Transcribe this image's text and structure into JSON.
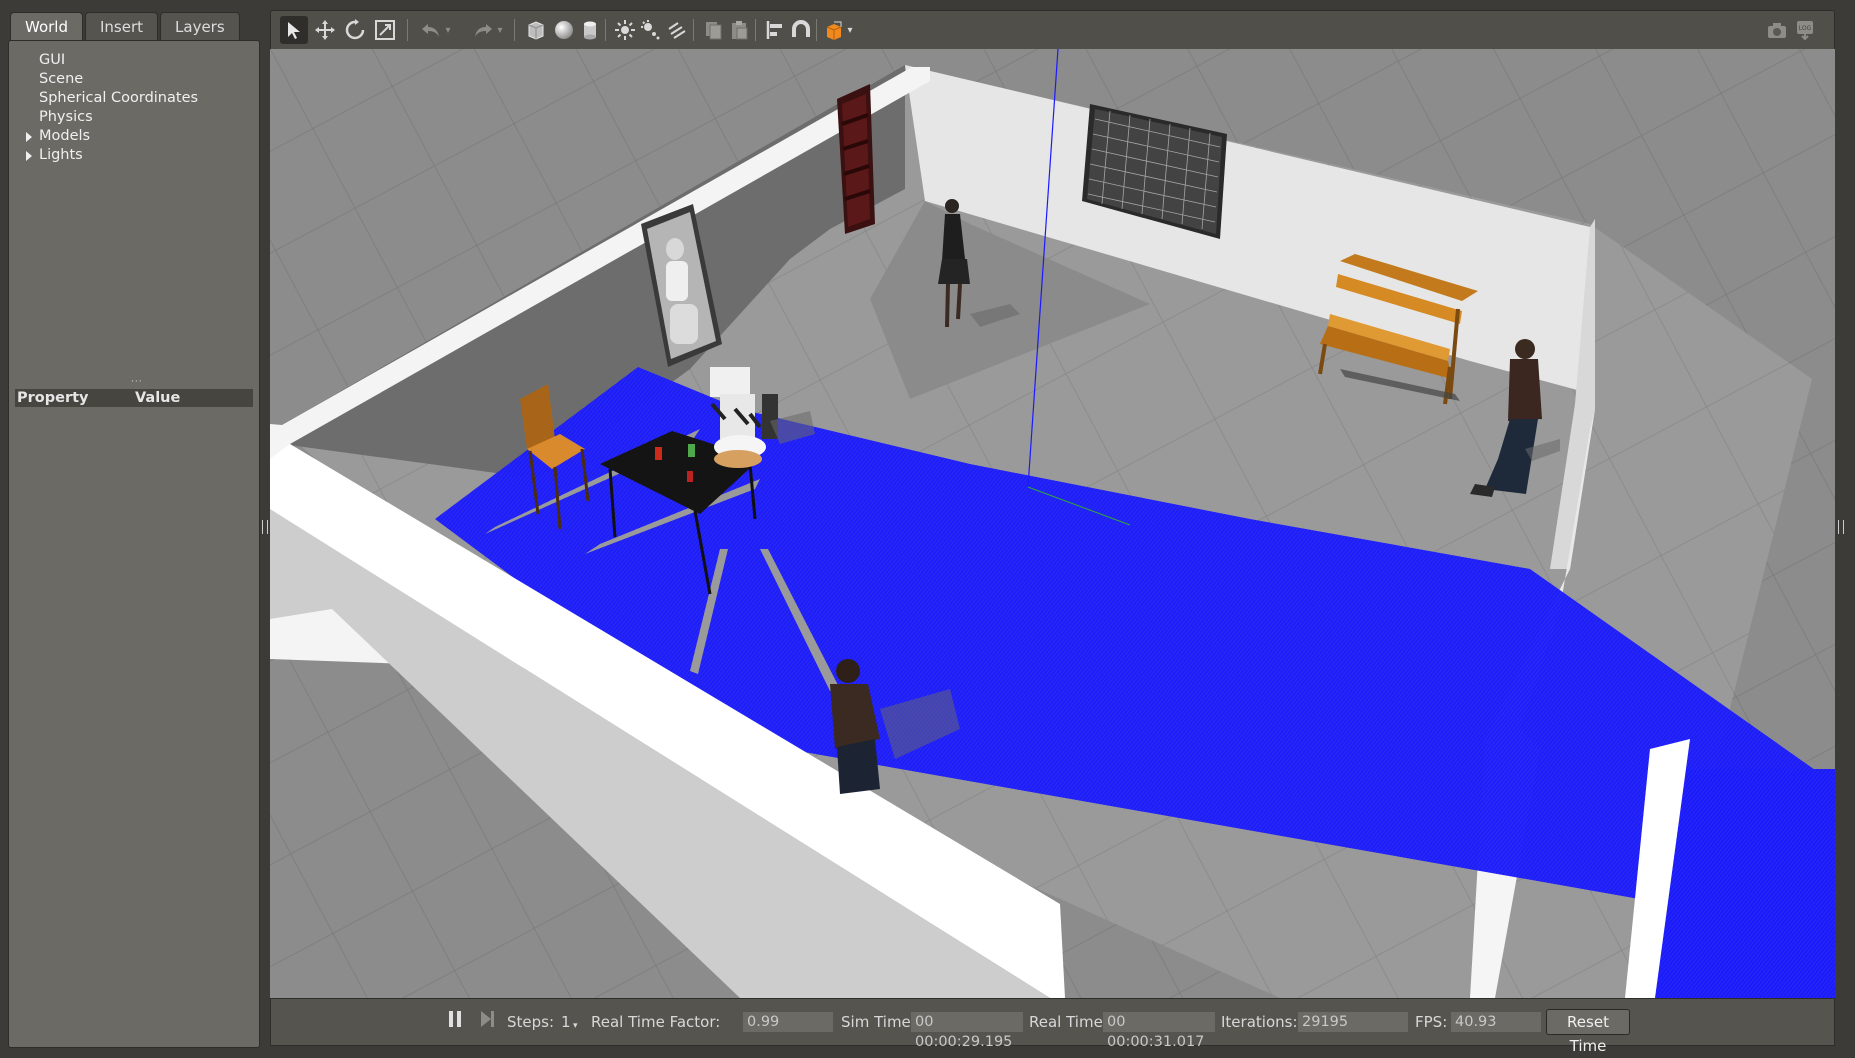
{
  "left_panel": {
    "tabs": [
      "World",
      "Insert",
      "Layers"
    ],
    "tree": [
      {
        "label": "GUI",
        "expandable": false
      },
      {
        "label": "Scene",
        "expandable": false
      },
      {
        "label": "Spherical Coordinates",
        "expandable": false
      },
      {
        "label": "Physics",
        "expandable": false
      },
      {
        "label": "Models",
        "expandable": true
      },
      {
        "label": "Lights",
        "expandable": true
      }
    ],
    "property_header": {
      "property": "Property",
      "value": "Value"
    }
  },
  "toolbar": {
    "tools": [
      "select-arrow-icon",
      "translate-icon",
      "rotate-icon",
      "scale-icon",
      "undo-icon",
      "redo-icon",
      "box-icon",
      "sphere-icon",
      "cylinder-icon",
      "point-light-icon",
      "spot-light-icon",
      "directional-light-icon",
      "copy-icon",
      "paste-icon",
      "align-icon",
      "snap-icon",
      "view-angle-icon",
      "screenshot-icon",
      "log-icon"
    ],
    "active_tool": "select-arrow-icon"
  },
  "statusbar": {
    "steps_label": "Steps:",
    "steps_value": "1",
    "rtf_label": "Real Time Factor:",
    "rtf_value": "0.99",
    "sim_time_label": "Sim Time:",
    "sim_time_value": "00 00:00:29.195",
    "real_time_label": "Real Time:",
    "real_time_value": "00 00:00:31.017",
    "iterations_label": "Iterations:",
    "iterations_value": "29195",
    "fps_label": "FPS:",
    "fps_value": "40.93",
    "reset_label": "Reset Time"
  },
  "colors": {
    "window_bg": "#3c3b37",
    "panel_bg": "#6b6a64",
    "laser_scan": "#1a1aff",
    "floor": "#8a8a8a",
    "wall": "#e8e8e8"
  }
}
